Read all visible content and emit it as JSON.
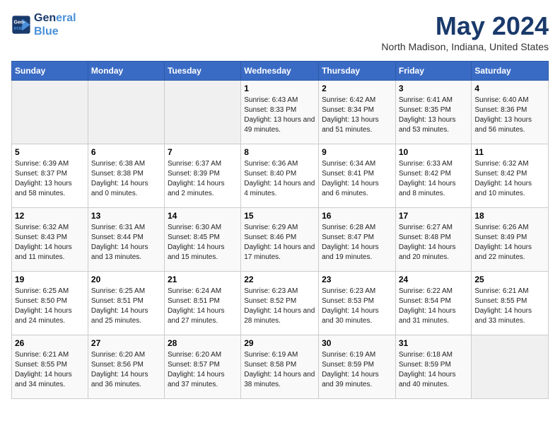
{
  "header": {
    "logo_line1": "General",
    "logo_line2": "Blue",
    "month_title": "May 2024",
    "location": "North Madison, Indiana, United States"
  },
  "days_of_week": [
    "Sunday",
    "Monday",
    "Tuesday",
    "Wednesday",
    "Thursday",
    "Friday",
    "Saturday"
  ],
  "weeks": [
    [
      {
        "day": "",
        "info": ""
      },
      {
        "day": "",
        "info": ""
      },
      {
        "day": "",
        "info": ""
      },
      {
        "day": "1",
        "info": "Sunrise: 6:43 AM\nSunset: 8:33 PM\nDaylight: 13 hours and 49 minutes."
      },
      {
        "day": "2",
        "info": "Sunrise: 6:42 AM\nSunset: 8:34 PM\nDaylight: 13 hours and 51 minutes."
      },
      {
        "day": "3",
        "info": "Sunrise: 6:41 AM\nSunset: 8:35 PM\nDaylight: 13 hours and 53 minutes."
      },
      {
        "day": "4",
        "info": "Sunrise: 6:40 AM\nSunset: 8:36 PM\nDaylight: 13 hours and 56 minutes."
      }
    ],
    [
      {
        "day": "5",
        "info": "Sunrise: 6:39 AM\nSunset: 8:37 PM\nDaylight: 13 hours and 58 minutes."
      },
      {
        "day": "6",
        "info": "Sunrise: 6:38 AM\nSunset: 8:38 PM\nDaylight: 14 hours and 0 minutes."
      },
      {
        "day": "7",
        "info": "Sunrise: 6:37 AM\nSunset: 8:39 PM\nDaylight: 14 hours and 2 minutes."
      },
      {
        "day": "8",
        "info": "Sunrise: 6:36 AM\nSunset: 8:40 PM\nDaylight: 14 hours and 4 minutes."
      },
      {
        "day": "9",
        "info": "Sunrise: 6:34 AM\nSunset: 8:41 PM\nDaylight: 14 hours and 6 minutes."
      },
      {
        "day": "10",
        "info": "Sunrise: 6:33 AM\nSunset: 8:42 PM\nDaylight: 14 hours and 8 minutes."
      },
      {
        "day": "11",
        "info": "Sunrise: 6:32 AM\nSunset: 8:42 PM\nDaylight: 14 hours and 10 minutes."
      }
    ],
    [
      {
        "day": "12",
        "info": "Sunrise: 6:32 AM\nSunset: 8:43 PM\nDaylight: 14 hours and 11 minutes."
      },
      {
        "day": "13",
        "info": "Sunrise: 6:31 AM\nSunset: 8:44 PM\nDaylight: 14 hours and 13 minutes."
      },
      {
        "day": "14",
        "info": "Sunrise: 6:30 AM\nSunset: 8:45 PM\nDaylight: 14 hours and 15 minutes."
      },
      {
        "day": "15",
        "info": "Sunrise: 6:29 AM\nSunset: 8:46 PM\nDaylight: 14 hours and 17 minutes."
      },
      {
        "day": "16",
        "info": "Sunrise: 6:28 AM\nSunset: 8:47 PM\nDaylight: 14 hours and 19 minutes."
      },
      {
        "day": "17",
        "info": "Sunrise: 6:27 AM\nSunset: 8:48 PM\nDaylight: 14 hours and 20 minutes."
      },
      {
        "day": "18",
        "info": "Sunrise: 6:26 AM\nSunset: 8:49 PM\nDaylight: 14 hours and 22 minutes."
      }
    ],
    [
      {
        "day": "19",
        "info": "Sunrise: 6:25 AM\nSunset: 8:50 PM\nDaylight: 14 hours and 24 minutes."
      },
      {
        "day": "20",
        "info": "Sunrise: 6:25 AM\nSunset: 8:51 PM\nDaylight: 14 hours and 25 minutes."
      },
      {
        "day": "21",
        "info": "Sunrise: 6:24 AM\nSunset: 8:51 PM\nDaylight: 14 hours and 27 minutes."
      },
      {
        "day": "22",
        "info": "Sunrise: 6:23 AM\nSunset: 8:52 PM\nDaylight: 14 hours and 28 minutes."
      },
      {
        "day": "23",
        "info": "Sunrise: 6:23 AM\nSunset: 8:53 PM\nDaylight: 14 hours and 30 minutes."
      },
      {
        "day": "24",
        "info": "Sunrise: 6:22 AM\nSunset: 8:54 PM\nDaylight: 14 hours and 31 minutes."
      },
      {
        "day": "25",
        "info": "Sunrise: 6:21 AM\nSunset: 8:55 PM\nDaylight: 14 hours and 33 minutes."
      }
    ],
    [
      {
        "day": "26",
        "info": "Sunrise: 6:21 AM\nSunset: 8:55 PM\nDaylight: 14 hours and 34 minutes."
      },
      {
        "day": "27",
        "info": "Sunrise: 6:20 AM\nSunset: 8:56 PM\nDaylight: 14 hours and 36 minutes."
      },
      {
        "day": "28",
        "info": "Sunrise: 6:20 AM\nSunset: 8:57 PM\nDaylight: 14 hours and 37 minutes."
      },
      {
        "day": "29",
        "info": "Sunrise: 6:19 AM\nSunset: 8:58 PM\nDaylight: 14 hours and 38 minutes."
      },
      {
        "day": "30",
        "info": "Sunrise: 6:19 AM\nSunset: 8:59 PM\nDaylight: 14 hours and 39 minutes."
      },
      {
        "day": "31",
        "info": "Sunrise: 6:18 AM\nSunset: 8:59 PM\nDaylight: 14 hours and 40 minutes."
      },
      {
        "day": "",
        "info": ""
      }
    ]
  ]
}
